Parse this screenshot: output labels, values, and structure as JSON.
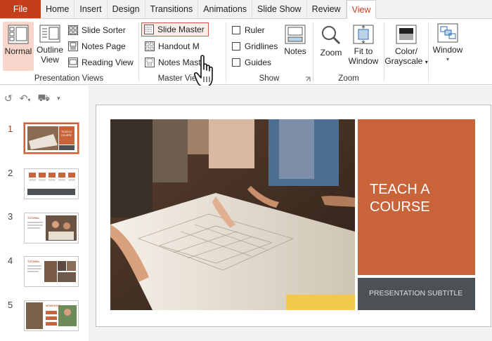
{
  "tabs": [
    {
      "label": "File"
    },
    {
      "label": "Home"
    },
    {
      "label": "Insert"
    },
    {
      "label": "Design"
    },
    {
      "label": "Transitions"
    },
    {
      "label": "Animations"
    },
    {
      "label": "Slide Show"
    },
    {
      "label": "Review"
    },
    {
      "label": "View"
    }
  ],
  "ribbon": {
    "presentation_views": {
      "label": "Presentation Views",
      "normal": "Normal",
      "outline_view_1": "Outline",
      "outline_view_2": "View",
      "slide_sorter": "Slide Sorter",
      "notes_page": "Notes Page",
      "reading_view": "Reading View"
    },
    "master_views": {
      "label": "Master Views",
      "slide_master": "Slide Master",
      "handout_master": "Handout M",
      "notes_master": "Notes Mast"
    },
    "show": {
      "label": "Show",
      "ruler": "Ruler",
      "gridlines": "Gridlines",
      "guides": "Guides",
      "notes": "Notes"
    },
    "zoom": {
      "label": "Zoom",
      "zoom": "Zoom",
      "fit_1": "Fit to",
      "fit_2": "Window"
    },
    "color": {
      "line1": "Color/",
      "line2": "Grayscale"
    },
    "window": {
      "label": "Window"
    }
  },
  "thumbnails": [
    {
      "num": "1",
      "title_mini": "TEACH A COURSE"
    },
    {
      "num": "2"
    },
    {
      "num": "3",
      "title_mini": "TUTORIAL"
    },
    {
      "num": "4",
      "title_mini": "TUTORIAL"
    },
    {
      "num": "5",
      "title_mini": "WORKSHOP"
    }
  ],
  "slide": {
    "title": "TEACH A COURSE",
    "subtitle": "PRESENTATION SUBTITLE"
  },
  "colors": {
    "accent": "#c43e1c",
    "title_box": "#c8633a",
    "subtitle_box": "#4b5154"
  }
}
